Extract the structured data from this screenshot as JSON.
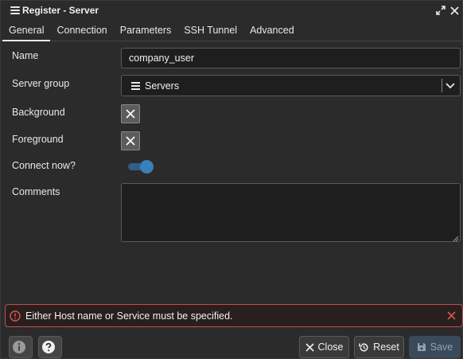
{
  "window": {
    "title": "Register - Server",
    "title_icon": "server-icon",
    "controls": [
      "maximize-icon",
      "close-icon"
    ]
  },
  "tabs": [
    {
      "label": "General",
      "active": true
    },
    {
      "label": "Connection",
      "active": false
    },
    {
      "label": "Parameters",
      "active": false
    },
    {
      "label": "SSH Tunnel",
      "active": false
    },
    {
      "label": "Advanced",
      "active": false
    }
  ],
  "form": {
    "name_label": "Name",
    "name_value": "company_user",
    "server_group_label": "Server group",
    "server_group_value": "Servers",
    "server_group_icon": "server-icon",
    "background_label": "Background",
    "foreground_label": "Foreground",
    "connect_now_label": "Connect now?",
    "connect_now": true,
    "comments_label": "Comments",
    "comments_value": ""
  },
  "error": {
    "message": "Either Host name or Service must be specified.",
    "icon": "alert-circle-icon",
    "color": "#c0504d"
  },
  "footer": {
    "info_icon": "info-icon",
    "help_icon": "help-icon",
    "close_label": "Close",
    "reset_label": "Reset",
    "save_label": "Save"
  },
  "colors": {
    "accent": "#3b7fb8",
    "background": "#2b2b2b"
  }
}
